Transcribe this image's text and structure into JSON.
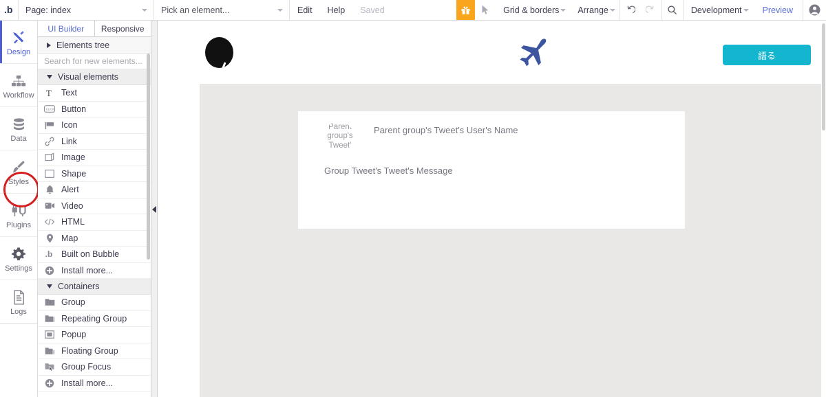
{
  "topbar": {
    "logo_icon": "bubble-logo-icon",
    "page_selector": "Page: index",
    "element_selector": "Pick an element...",
    "edit_label": "Edit",
    "help_label": "Help",
    "saved_label": "Saved",
    "gift_icon": "gift-icon",
    "cursor_icon": "cursor-pointer-icon",
    "grid_borders_label": "Grid & borders",
    "arrange_label": "Arrange",
    "undo_icon": "undo-icon",
    "redo_icon": "redo-icon",
    "search_icon": "search-icon",
    "version_label": "Development",
    "preview_label": "Preview",
    "avatar_icon": "user-avatar-icon",
    "gift_color": "#f9a61e",
    "preview_color": "#5b6fd6"
  },
  "rail": {
    "items": [
      {
        "label": "Design",
        "icon": "design-tools-icon",
        "active": true
      },
      {
        "label": "Workflow",
        "icon": "workflow-tree-icon",
        "active": false
      },
      {
        "label": "Data",
        "icon": "database-icon",
        "active": false
      },
      {
        "label": "Styles",
        "icon": "paintbrush-icon",
        "active": false
      },
      {
        "label": "Plugins",
        "icon": "plugins-icon",
        "active": false
      },
      {
        "label": "Settings",
        "icon": "gear-icon",
        "active": false
      },
      {
        "label": "Logs",
        "icon": "document-lines-icon",
        "active": false
      }
    ],
    "annotation_color": "#d61f1f",
    "annotated_item": "Plugins"
  },
  "panel": {
    "tabs": [
      {
        "label": "UI Builder",
        "active": true
      },
      {
        "label": "Responsive",
        "active": false
      }
    ],
    "elements_tree_label": "Elements tree",
    "search_placeholder": "Search for new elements...",
    "sections": [
      {
        "title": "Visual elements",
        "items": [
          {
            "label": "Text",
            "icon": "text-serif-t-icon"
          },
          {
            "label": "Button",
            "icon": "click-button-icon"
          },
          {
            "label": "Icon",
            "icon": "flag-icon"
          },
          {
            "label": "Link",
            "icon": "link-chain-icon"
          },
          {
            "label": "Image",
            "icon": "image-icon"
          },
          {
            "label": "Shape",
            "icon": "rectangle-shape-icon"
          },
          {
            "label": "Alert",
            "icon": "bell-alert-icon"
          },
          {
            "label": "Video",
            "icon": "video-camera-icon"
          },
          {
            "label": "HTML",
            "icon": "code-brackets-icon"
          },
          {
            "label": "Map",
            "icon": "map-pin-icon"
          },
          {
            "label": "Built on Bubble",
            "icon": "bubble-logo-icon"
          },
          {
            "label": "Install more...",
            "icon": "plus-circle-icon"
          }
        ]
      },
      {
        "title": "Containers",
        "items": [
          {
            "label": "Group",
            "icon": "folder-group-icon"
          },
          {
            "label": "Repeating Group",
            "icon": "repeating-group-icon"
          },
          {
            "label": "Popup",
            "icon": "popup-window-icon"
          },
          {
            "label": "Floating Group",
            "icon": "floating-group-icon"
          },
          {
            "label": "Group Focus",
            "icon": "group-focus-icon"
          },
          {
            "label": "Install more...",
            "icon": "plus-circle-icon"
          }
        ]
      }
    ]
  },
  "canvas": {
    "header": {
      "avatar_icon": "black-circle-avatar-icon",
      "plane_icon": "airplane-icon",
      "plane_color": "#3d55a0",
      "cta_label": "語る",
      "cta_color": "#13b5cf"
    },
    "body_color": "#e9e8e7",
    "card": {
      "avatar_placeholder_text": "Parent group's Tweet'",
      "username_text": "Parent group's Tweet's User's Name",
      "message_text": "Group Tweet's Tweet's Message"
    }
  }
}
